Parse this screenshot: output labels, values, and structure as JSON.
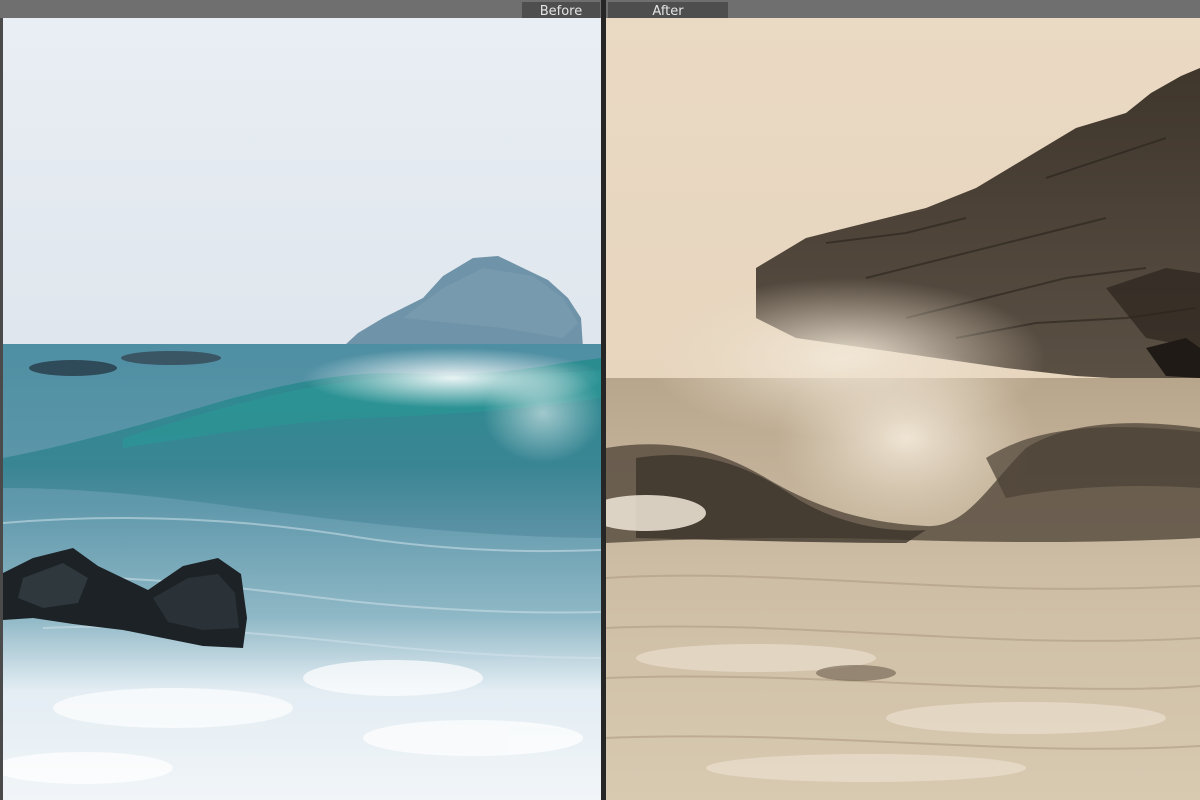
{
  "compare_view": {
    "before_label": "Before",
    "after_label": "After"
  },
  "colors": {
    "toolbar": "#6f6f6f",
    "label_bg": "#4e4e4e",
    "divider": "#262626"
  }
}
